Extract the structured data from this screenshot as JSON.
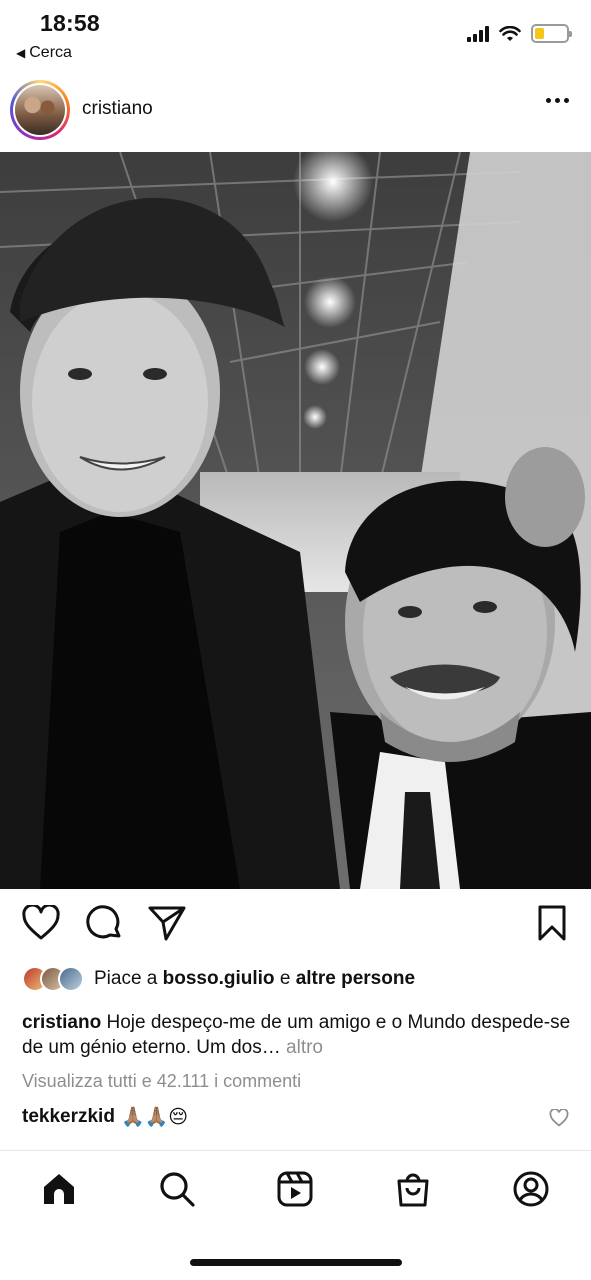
{
  "status_bar": {
    "time": "18:58",
    "back_label": "Cerca",
    "battery_color": "#f5c518"
  },
  "post": {
    "username": "cristiano",
    "photo_description_icon": "photo-black-and-white"
  },
  "actions": {
    "like_icon": "heart-icon",
    "comment_icon": "comment-icon",
    "share_icon": "send-icon",
    "save_icon": "bookmark-icon"
  },
  "likes": {
    "prefix": "Piace a",
    "user": "bosso.giulio",
    "connector": "e",
    "others": "altre persone"
  },
  "caption": {
    "username": "cristiano",
    "text": "Hoje despeço-me de um amigo e o Mundo despede-se de um génio eterno. Um dos…",
    "more": "altro"
  },
  "comments": {
    "view_all": "Visualizza tutti e 42.111 i commenti",
    "items": [
      {
        "username": "tekkerzkid",
        "emoji": "🙏🏽🙏🏽😔"
      }
    ]
  },
  "tab_bar": {
    "items": [
      "home-icon",
      "search-icon",
      "reels-icon",
      "shop-icon",
      "profile-icon"
    ]
  }
}
